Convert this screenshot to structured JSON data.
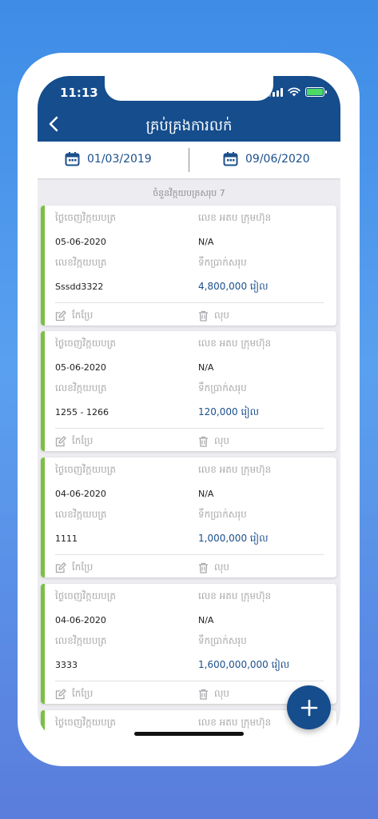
{
  "status_bar": {
    "time": "11:13"
  },
  "header": {
    "title": "គ្រប់គ្រងការលក់"
  },
  "date_filter": {
    "start": "01/03/2019",
    "end": "09/06/2020"
  },
  "summary": {
    "total_label": "ចំនួនវិក្កយបត្រសរុប 7"
  },
  "labels": {
    "issue_date": "ថ្ងៃចេញវិក្កយបត្រ",
    "company_vat": "លេខ អតប ក្រុមហ៊ុន",
    "invoice_no": "លេខវិក្កយបត្រ",
    "total_amount": "ទឹកប្រាក់សរុប",
    "edit": "កែប្រែ",
    "delete": "លុប"
  },
  "invoices": [
    {
      "date": "05-06-2020",
      "vat": "N/A",
      "number": "Sssdd3322",
      "amount": "4,800,000 រៀល"
    },
    {
      "date": "05-06-2020",
      "vat": "N/A",
      "number": "1255 - 1266",
      "amount": "120,000 រៀល"
    },
    {
      "date": "04-06-2020",
      "vat": "N/A",
      "number": "1111",
      "amount": "1,000,000 រៀល"
    },
    {
      "date": "04-06-2020",
      "vat": "N/A",
      "number": "3333",
      "amount": "1,600,000,000 រៀល"
    }
  ],
  "colors": {
    "primary": "#154d8d",
    "accent": "#7bc043",
    "background": "#3d8ce6"
  },
  "icons": {
    "back": "chevron-left-icon",
    "calendar": "calendar-icon",
    "edit": "pencil-icon",
    "delete": "trash-icon",
    "add": "plus-icon"
  }
}
